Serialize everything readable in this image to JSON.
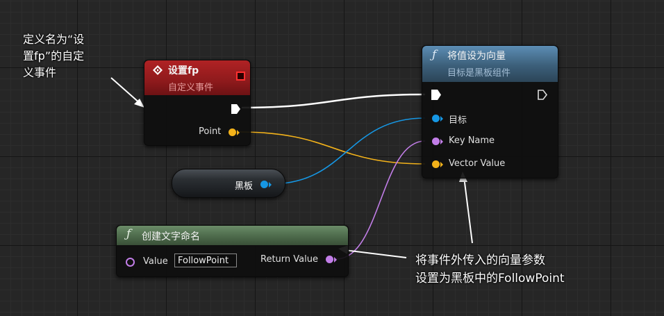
{
  "event_node": {
    "title": "设置fp",
    "subtitle": "自定义事件",
    "output_pin_label": "Point"
  },
  "set_vector_node": {
    "title": "将值设为向量",
    "subtitle": "目标是黑板组件",
    "pins": {
      "target": "目标",
      "key_name": "Key Name",
      "vector_value": "Vector Value"
    }
  },
  "blackboard_variable": {
    "label": "黑板"
  },
  "make_name_node": {
    "title": "创建文字命名",
    "value_label": "Value",
    "value_input": "FollowPoint",
    "return_label": "Return Value"
  },
  "annotations": {
    "event_note_lines": [
      "定义名为“设",
      "置fp”的自定义事件"
    ],
    "event_note_line3": "义事件",
    "bottom_note_line1": "将事件外传入的向量参数",
    "bottom_note_line2": "设置为黑板中的FollowPoint"
  },
  "icons": {
    "event": "diamond-event-icon",
    "function": "function-f-icon",
    "exec": "exec-arrow-icon"
  },
  "colors": {
    "event_header": "#8e1a1c",
    "function_header": "#3c5f7a",
    "pure_function_header": "#4d6a4b",
    "exec_wire": "#ffffff",
    "vector_pin": "#f3b21a",
    "object_pin": "#1697e4",
    "name_pin": "#c27ee8"
  }
}
